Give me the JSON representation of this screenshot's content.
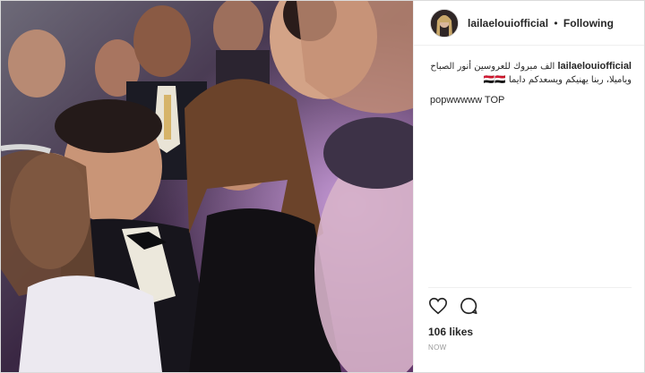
{
  "post": {
    "username": "lailaelouiofficial",
    "separator": "•",
    "follow_status": "Following",
    "caption_text": "الف مبروك للعروسين أنور الصباح وياميلا، ربنا يهنيكم ويسعدكم دايما 🇾🇪🇾🇪",
    "comment_text": "popwwwww TOP",
    "likes": "106 likes",
    "timestamp": "NOW"
  },
  "icons": {
    "like": "heart-icon",
    "comment": "speech-bubble-icon"
  },
  "colors": {
    "text": "#262626",
    "border": "#dbdbdb",
    "muted": "#999999"
  }
}
